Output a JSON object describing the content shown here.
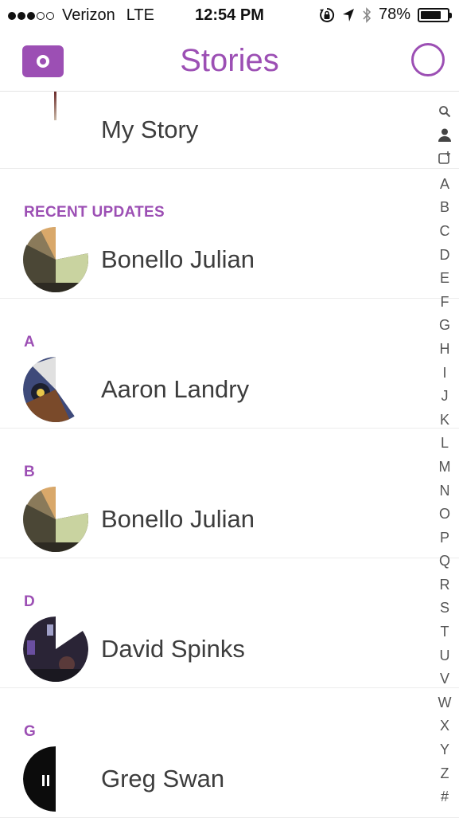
{
  "status_bar": {
    "signal": "●●●○○",
    "carrier": "Verizon",
    "network": "LTE",
    "time": "12:54 PM",
    "battery": "78%",
    "battery_level": 0.78
  },
  "header": {
    "title": "Stories",
    "left_icon": "camera-icon",
    "right_icon": "record-circle-icon"
  },
  "my_story": {
    "label": "My Story"
  },
  "sections": [
    {
      "header": "RECENT UPDATES",
      "items": [
        {
          "name": "Bonello Julian"
        }
      ]
    },
    {
      "header": "A",
      "items": [
        {
          "name": "Aaron Landry"
        }
      ]
    },
    {
      "header": "B",
      "items": [
        {
          "name": "Bonello Julian"
        }
      ]
    },
    {
      "header": "D",
      "items": [
        {
          "name": "David Spinks"
        }
      ]
    },
    {
      "header": "G",
      "items": [
        {
          "name": "Greg Swan"
        }
      ]
    }
  ],
  "index_bar": [
    "search-icon",
    "person-icon",
    "add-friend-icon",
    "A",
    "B",
    "C",
    "D",
    "E",
    "F",
    "G",
    "H",
    "I",
    "J",
    "K",
    "L",
    "M",
    "N",
    "O",
    "P",
    "Q",
    "R",
    "S",
    "T",
    "U",
    "V",
    "W",
    "X",
    "Y",
    "Z",
    "#"
  ],
  "colors": {
    "accent": "#9c4fb4",
    "text": "#3d3d3d"
  }
}
